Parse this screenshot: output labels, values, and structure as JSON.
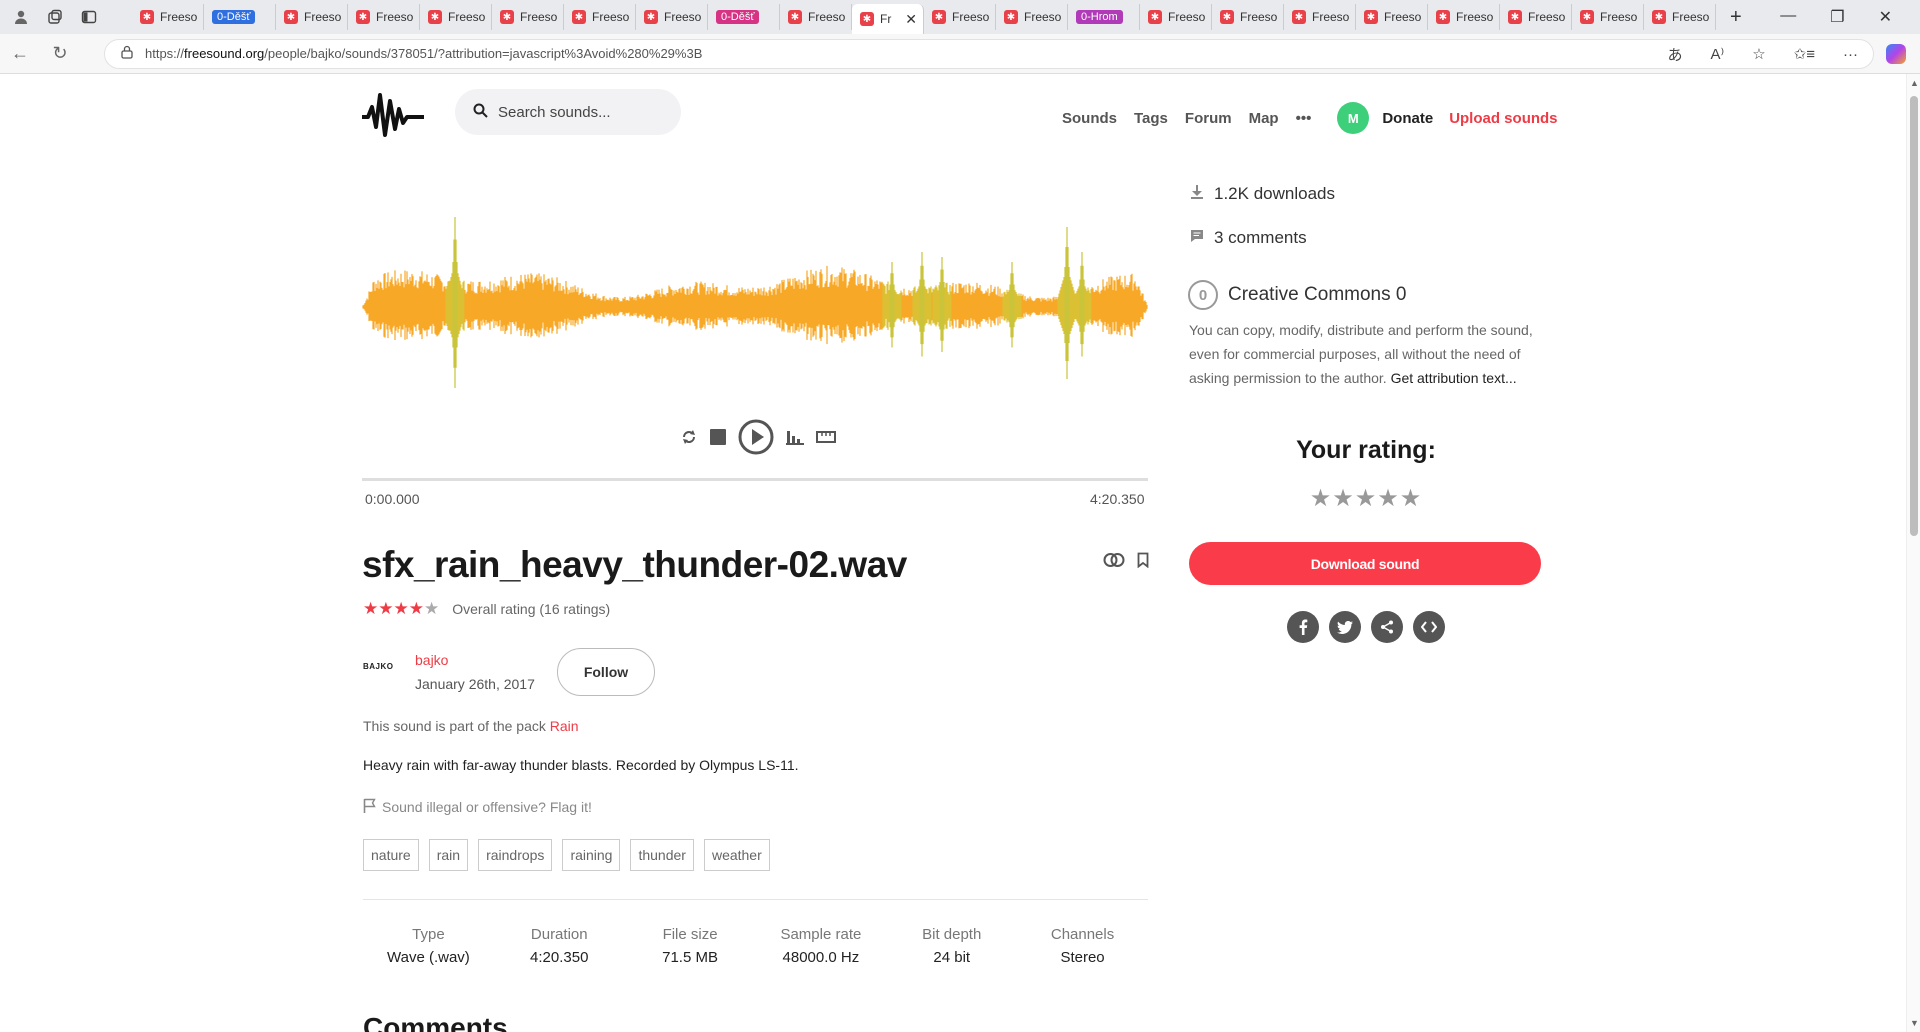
{
  "browser": {
    "tabs": [
      {
        "label": "Freeso",
        "type": "fav"
      },
      {
        "label": "0-Děšť",
        "type": "pill",
        "color": "#2f6fe0"
      },
      {
        "label": "Freeso",
        "type": "fav"
      },
      {
        "label": "Freeso",
        "type": "fav"
      },
      {
        "label": "Freeso",
        "type": "fav"
      },
      {
        "label": "Freeso",
        "type": "fav"
      },
      {
        "label": "Freeso",
        "type": "fav"
      },
      {
        "label": "Freeso",
        "type": "fav"
      },
      {
        "label": "0-Děšť",
        "type": "pill",
        "color": "#d63384"
      },
      {
        "label": "Freeso",
        "type": "fav"
      },
      {
        "label": "Fr",
        "type": "active"
      },
      {
        "label": "Freeso",
        "type": "fav"
      },
      {
        "label": "Freeso",
        "type": "fav"
      },
      {
        "label": "0-Hrom",
        "type": "pill",
        "color": "#b03ab8"
      },
      {
        "label": "Freeso",
        "type": "fav"
      },
      {
        "label": "Freeso",
        "type": "fav"
      },
      {
        "label": "Freeso",
        "type": "fav"
      },
      {
        "label": "Freeso",
        "type": "fav"
      },
      {
        "label": "Freeso",
        "type": "fav"
      },
      {
        "label": "Freeso",
        "type": "fav"
      },
      {
        "label": "Freeso",
        "type": "fav"
      },
      {
        "label": "Freeso",
        "type": "fav"
      }
    ],
    "url_prefix": "https://",
    "url_domain": "freesound.org",
    "url_path": "/people/bajko/sounds/378051/?attribution=javascript%3Avoid%280%29%3B"
  },
  "header": {
    "search_placeholder": "Search sounds...",
    "nav": [
      "Sounds",
      "Tags",
      "Forum",
      "Map"
    ],
    "more": "•••",
    "avatar_initial": "M",
    "donate": "Donate",
    "upload": "Upload sounds"
  },
  "player": {
    "time_start": "0:00.000",
    "time_end": "4:20.350",
    "wave_color": "#f7a827"
  },
  "sound": {
    "title": "sfx_rain_heavy_thunder-02.wav",
    "rating_stars": 4,
    "rating_text": "Overall rating (16 ratings)",
    "author_logo": "BAJKO",
    "author": "bajko",
    "date": "January 26th, 2017",
    "follow": "Follow",
    "pack_prefix": "This sound is part of the pack ",
    "pack_name": "Rain",
    "description": "Heavy rain with far-away thunder blasts. Recorded by Olympus LS-11.",
    "flag": "Sound illegal or offensive? Flag it!",
    "tags": [
      "nature",
      "rain",
      "raindrops",
      "raining",
      "thunder",
      "weather"
    ],
    "meta": [
      {
        "label": "Type",
        "value": "Wave (.wav)"
      },
      {
        "label": "Duration",
        "value": "4:20.350"
      },
      {
        "label": "File size",
        "value": "71.5 MB"
      },
      {
        "label": "Sample rate",
        "value": "48000.0 Hz"
      },
      {
        "label": "Bit depth",
        "value": "24 bit"
      },
      {
        "label": "Channels",
        "value": "Stereo"
      }
    ],
    "comments_heading": "Comments"
  },
  "sidebar": {
    "downloads": "1.2K downloads",
    "comments": "3 comments",
    "license_badge": "0",
    "license": "Creative Commons 0",
    "license_desc": "You can copy, modify, distribute and perform the sound, even for commercial purposes, all without the need of asking permission to the author.",
    "attribution_link": "Get attribution text...",
    "your_rating": "Your rating:",
    "download_btn": "Download sound",
    "social": [
      "f",
      "t",
      "share",
      "embed"
    ]
  },
  "colors": {
    "accent": "#ee3c46",
    "download_btn": "#fa3b4a",
    "avatar": "#3ecf7b"
  }
}
